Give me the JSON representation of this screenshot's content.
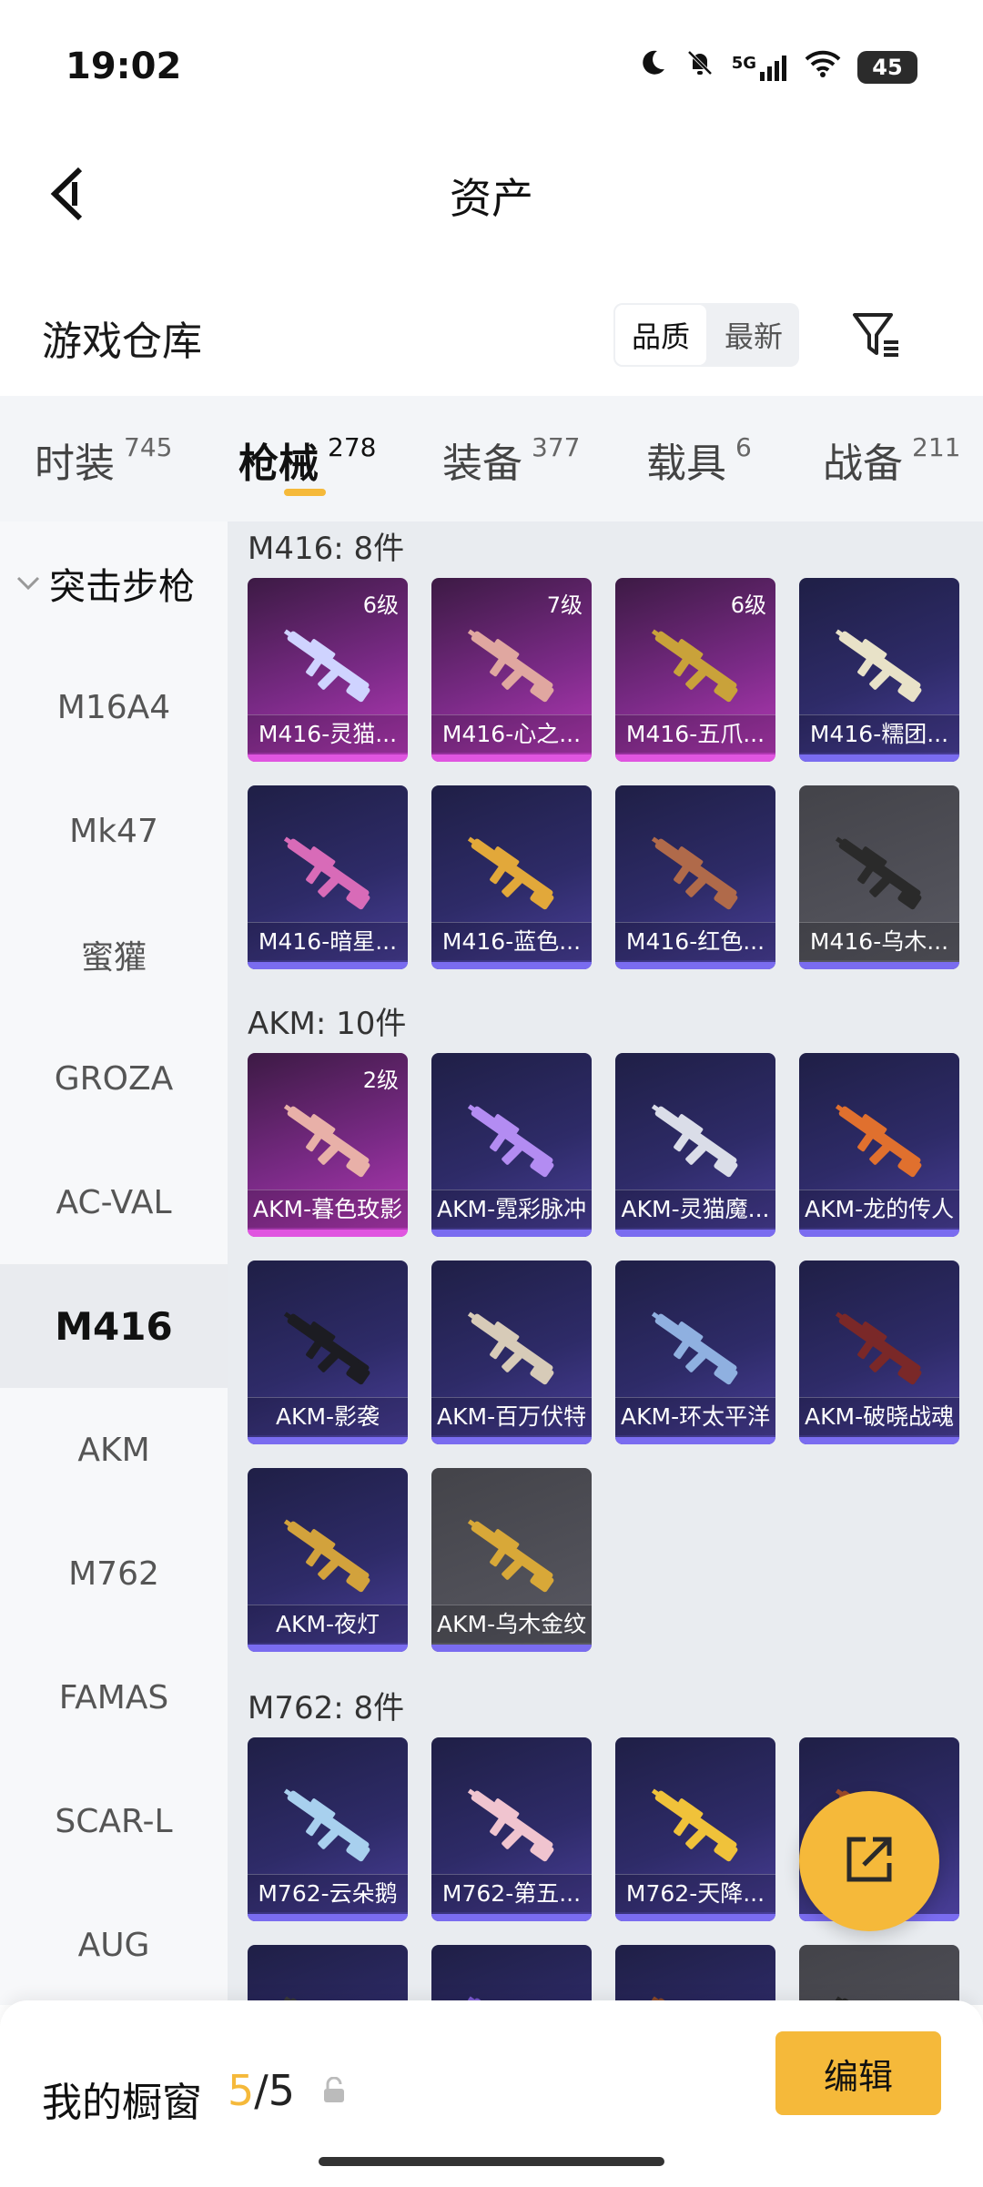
{
  "status": {
    "time": "19:02",
    "battery": "45",
    "network": "5G"
  },
  "header": {
    "title": "资产"
  },
  "warehouse": {
    "title": "游戏仓库",
    "sort_options": [
      "品质",
      "最新"
    ],
    "sort_active": "品质"
  },
  "categories": [
    {
      "label": "时装",
      "count": "745"
    },
    {
      "label": "枪械",
      "count": "278"
    },
    {
      "label": "装备",
      "count": "377"
    },
    {
      "label": "载具",
      "count": "6"
    },
    {
      "label": "战备",
      "count": "211"
    }
  ],
  "active_category": "枪械",
  "sidebar": {
    "group": "突击步枪",
    "items": [
      "M16A4",
      "Mk47",
      "蜜獾",
      "GROZA",
      "AC-VAL",
      "M416",
      "AKM",
      "M762",
      "FAMAS",
      "SCAR-L",
      "AUG"
    ],
    "active": "M416"
  },
  "sections": [
    {
      "title": "M416: 8件",
      "cards": [
        {
          "name": "M416-灵猫...",
          "level": "6级",
          "tier": "pink",
          "color": "#cfd3ff"
        },
        {
          "name": "M416-心之...",
          "level": "7级",
          "tier": "pink",
          "color": "#e0a7a0"
        },
        {
          "name": "M416-五爪...",
          "level": "6级",
          "tier": "pink",
          "color": "#c9a23a"
        },
        {
          "name": "M416-糯团...",
          "level": "",
          "tier": "purple",
          "color": "#e8e2c8"
        },
        {
          "name": "M416-暗星...",
          "level": "",
          "tier": "purple",
          "color": "#d86bb8"
        },
        {
          "name": "M416-蓝色...",
          "level": "",
          "tier": "purple",
          "color": "#e2a83a"
        },
        {
          "name": "M416-红色...",
          "level": "",
          "tier": "purple",
          "color": "#b06a4a"
        },
        {
          "name": "M416-乌木...",
          "level": "",
          "tier": "grey",
          "color": "#2a2a2a"
        }
      ]
    },
    {
      "title": "AKM: 10件",
      "cards": [
        {
          "name": "AKM-暮色玫影",
          "level": "2级",
          "tier": "pink",
          "color": "#e8b0a8"
        },
        {
          "name": "AKM-霓彩脉冲",
          "level": "",
          "tier": "purple",
          "color": "#b38cf2"
        },
        {
          "name": "AKM-灵猫魔...",
          "level": "",
          "tier": "purple",
          "color": "#dadde8"
        },
        {
          "name": "AKM-龙的传人",
          "level": "",
          "tier": "purple",
          "color": "#e0702e"
        },
        {
          "name": "AKM-影袭",
          "level": "",
          "tier": "purple",
          "color": "#1c1c22"
        },
        {
          "name": "AKM-百万伏特",
          "level": "",
          "tier": "purple",
          "color": "#d7cbb8"
        },
        {
          "name": "AKM-环太平洋",
          "level": "",
          "tier": "purple",
          "color": "#8fb0e0"
        },
        {
          "name": "AKM-破晓战魂",
          "level": "",
          "tier": "purple",
          "color": "#7a2828"
        },
        {
          "name": "AKM-夜灯",
          "level": "",
          "tier": "purple",
          "color": "#d2a23c"
        },
        {
          "name": "AKM-乌木金纹",
          "level": "",
          "tier": "grey",
          "color": "#d8a838"
        }
      ]
    },
    {
      "title": "M762: 8件",
      "cards": [
        {
          "name": "M762-云朵鹅",
          "level": "",
          "tier": "purple",
          "color": "#a8d0ee"
        },
        {
          "name": "M762-第五...",
          "level": "",
          "tier": "purple",
          "color": "#f0c4cf"
        },
        {
          "name": "M762-天降...",
          "level": "",
          "tier": "purple",
          "color": "#f0c23a"
        },
        {
          "name": "",
          "level": "",
          "tier": "purple",
          "color": "#9a4a2a"
        },
        {
          "name": "",
          "level": "",
          "tier": "purple",
          "color": "#3a3a3a"
        },
        {
          "name": "",
          "level": "",
          "tier": "purple",
          "color": "#7a5ad0"
        },
        {
          "name": "",
          "level": "",
          "tier": "purple",
          "color": "#8a4a2a"
        },
        {
          "name": "",
          "level": "",
          "tier": "grey",
          "color": "#2a2a2a"
        }
      ]
    }
  ],
  "showcase": {
    "label": "我的橱窗",
    "current": "5",
    "total": "/5",
    "edit_label": "编辑"
  },
  "accent_color": "#f5b93a"
}
